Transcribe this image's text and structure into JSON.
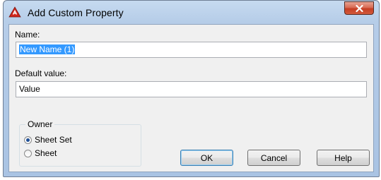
{
  "window": {
    "title": "Add Custom Property",
    "app_icon": "autocad-a-icon",
    "close_icon": "close-x-icon"
  },
  "form": {
    "name_label": "Name:",
    "name_value": "New Name (1)",
    "default_value_label": "Default value:",
    "default_value_value": "Value"
  },
  "owner": {
    "legend": "Owner",
    "options": [
      {
        "label": "Sheet Set",
        "selected": true
      },
      {
        "label": "Sheet",
        "selected": false
      }
    ]
  },
  "buttons": {
    "ok": "OK",
    "cancel": "Cancel",
    "help": "Help"
  },
  "colors": {
    "title_bar": "#b6cde8",
    "close_button": "#c53e23",
    "selection_highlight": "#3399ff",
    "client_background": "#f0f0f0"
  }
}
